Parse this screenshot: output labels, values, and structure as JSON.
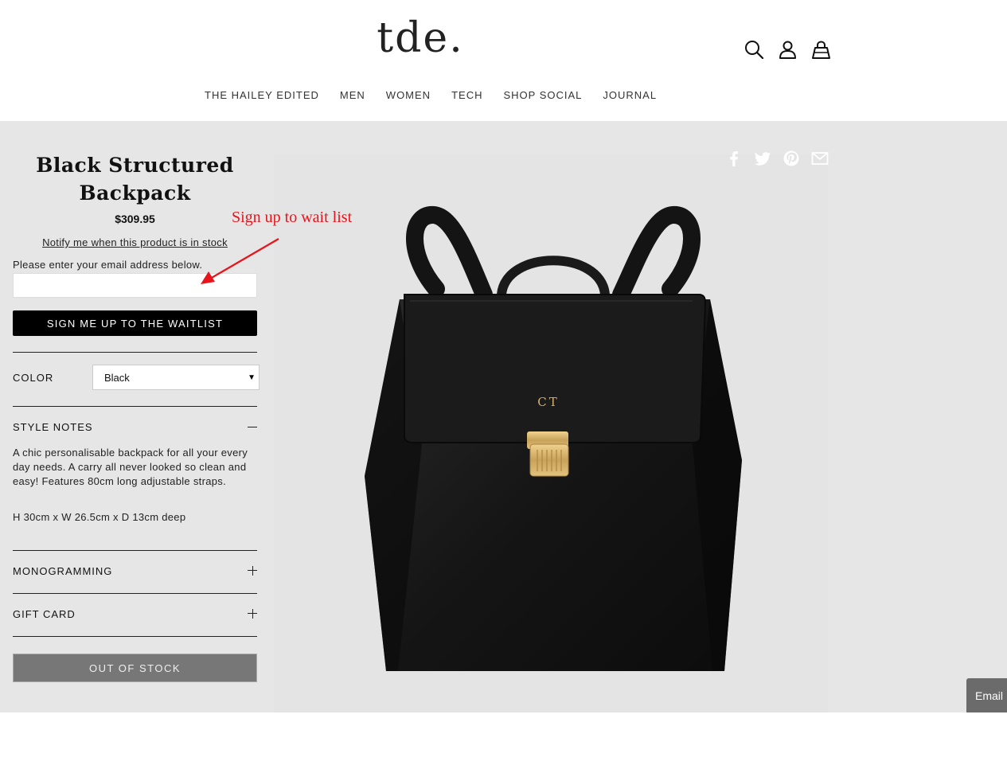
{
  "header": {
    "logo": "tde.",
    "icons": [
      "search-icon",
      "account-icon",
      "bag-icon"
    ],
    "nav": [
      "THE HAILEY EDITED",
      "MEN",
      "WOMEN",
      "TECH",
      "SHOP SOCIAL",
      "JOURNAL"
    ]
  },
  "product": {
    "title_line1": "Black Structured",
    "title_line2": "Backpack",
    "price": "$309.95",
    "notify_link": "Notify me when this product is in stock",
    "email_label": "Please enter your email address below.",
    "email_value": "",
    "waitlist_button": "SIGN ME UP TO THE WAITLIST",
    "color_label": "COLOR",
    "color_value": "Black",
    "style_notes_label": "STYLE NOTES",
    "style_notes_text": "A chic personalisable backpack for all your every day needs. A carry all never looked so clean and easy! Features 80cm long adjustable straps.",
    "dimensions": "H 30cm x W 26.5cm x D 13cm deep",
    "monogramming_label": "MONOGRAMMING",
    "gift_card_label": "GIFT CARD",
    "out_of_stock": "OUT OF STOCK",
    "monogram": "CT"
  },
  "annotation": {
    "text": "Sign up to wait list",
    "color": "#e8141b"
  },
  "social": [
    "facebook-icon",
    "twitter-icon",
    "pinterest-icon",
    "email-share-icon"
  ],
  "email_tab": "Email",
  "colors": {
    "panel_bg": "#e6e6e6",
    "button_black": "#000000",
    "button_disabled": "#777777"
  }
}
